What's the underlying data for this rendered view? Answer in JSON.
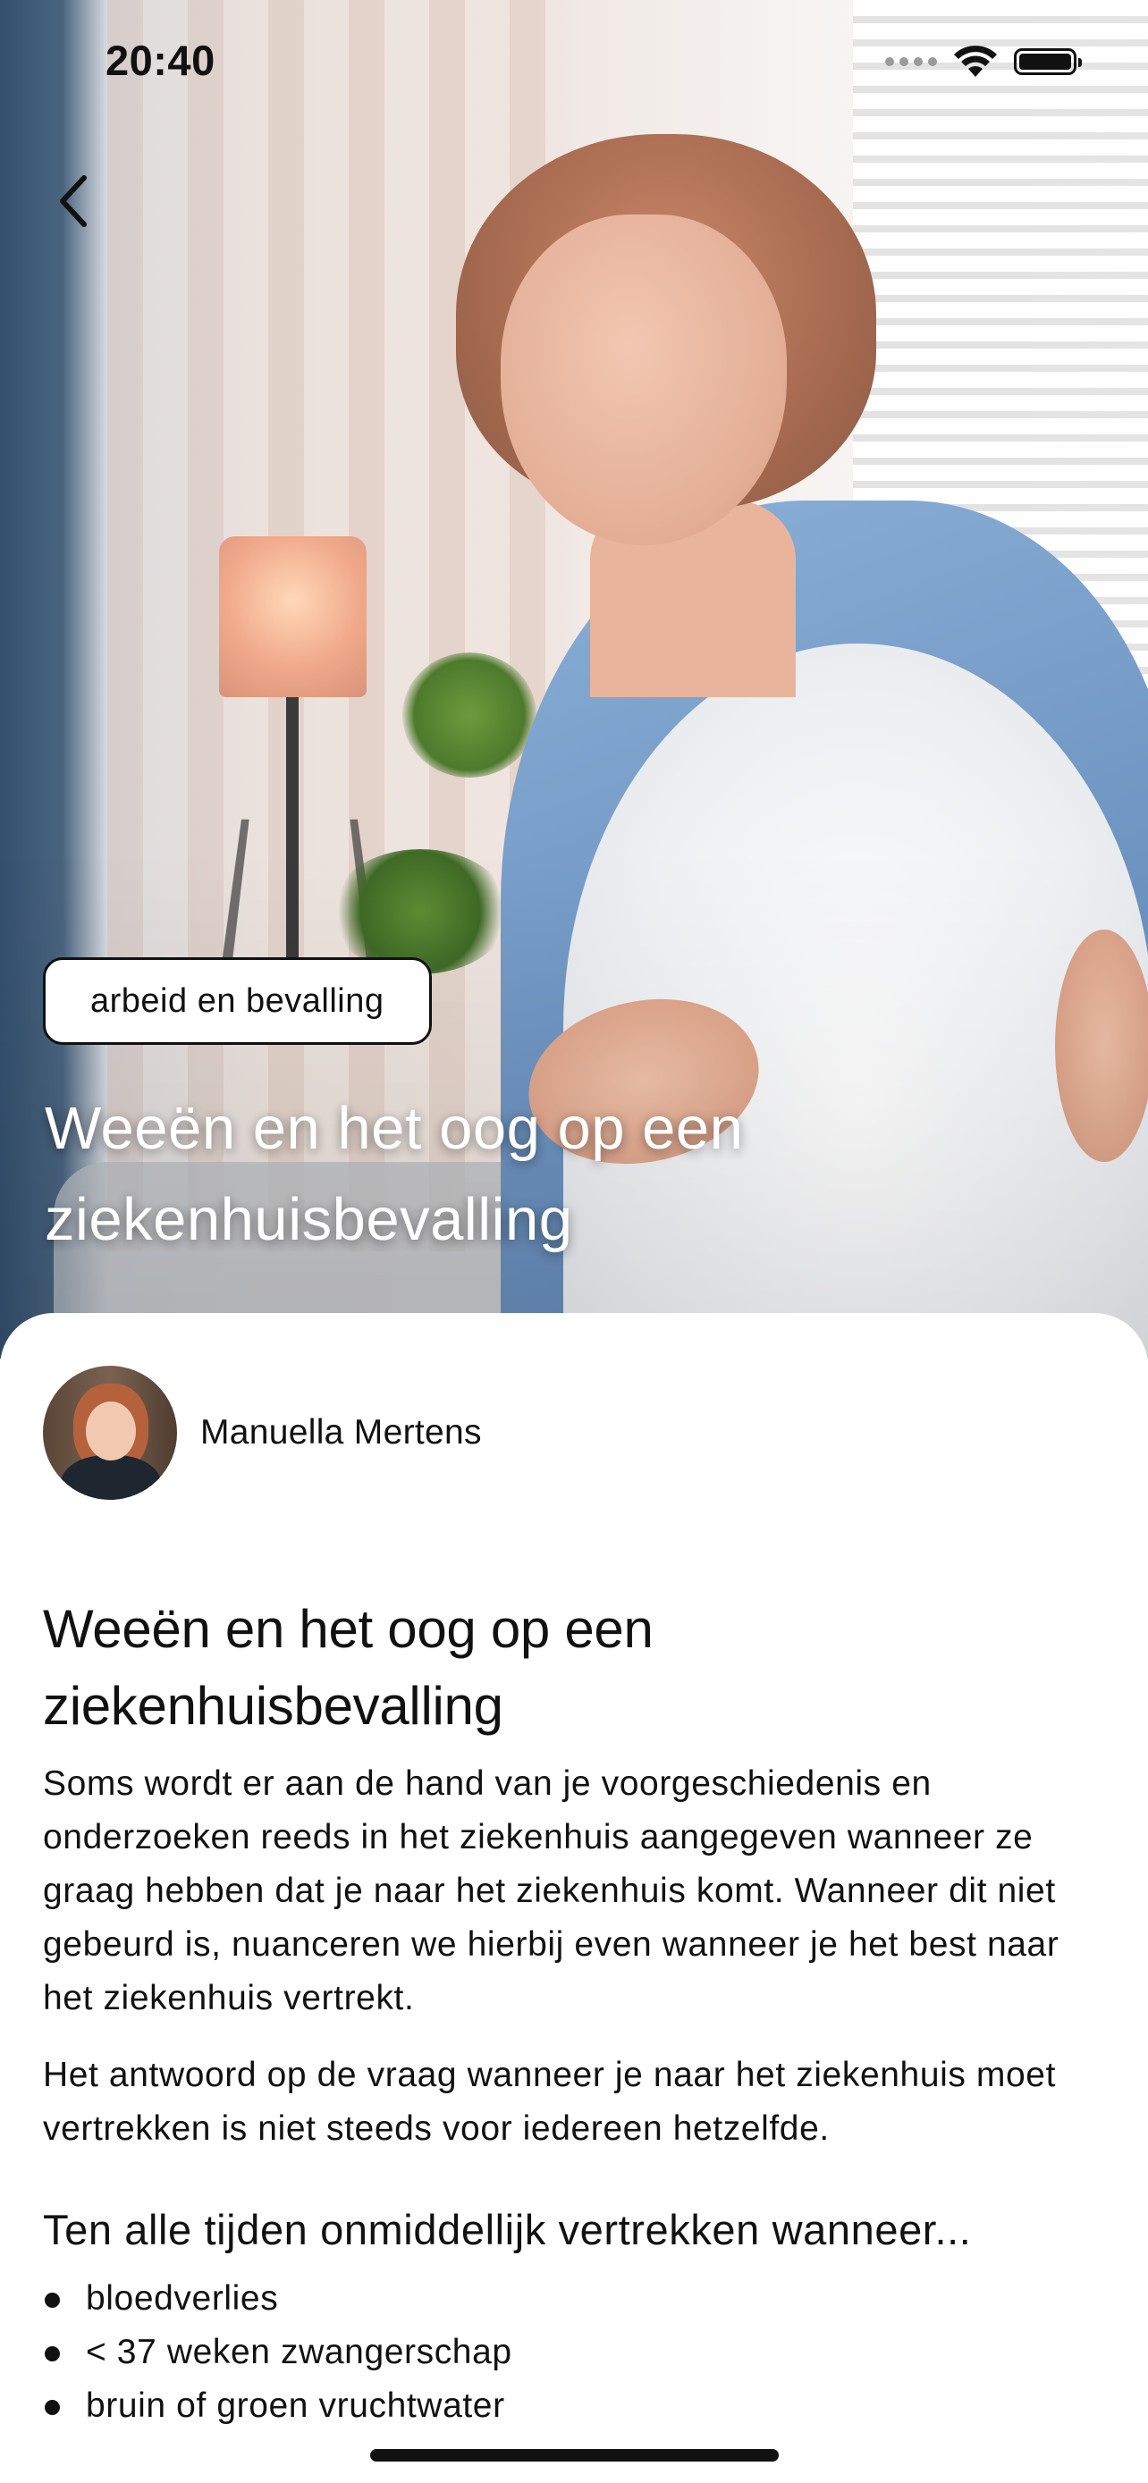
{
  "status_bar": {
    "time": "20:40"
  },
  "hero": {
    "category_label": "arbeid en bevalling",
    "title": "Weeën en het oog op een ziekenhuisbevalling"
  },
  "author": {
    "name": "Manuella Mertens"
  },
  "article": {
    "title": "Weeën en het oog op een ziekenhuisbevalling",
    "paragraphs": [
      "Soms wordt er aan de hand van je voorgeschiedenis en onderzoeken reeds in het ziekenhuis aangegeven wanneer ze graag hebben dat je naar het ziekenhuis komt. Wanneer dit niet gebeurd is, nuanceren we hierbij even wanneer je het best naar het ziekenhuis vertrekt.",
      "Het antwoord op de vraag wanneer je naar het ziekenhuis moet vertrekken is niet steeds voor iedereen hetzelfde."
    ],
    "subheading": "Ten alle tijden onmiddellijk vertrekken wanneer...",
    "bullets": [
      "bloedverlies",
      "< 37 weken zwangerschap",
      "bruin of groen vruchtwater"
    ]
  },
  "icons": {
    "back": "chevron-left-icon",
    "signal": "cellular-signal-icon",
    "wifi": "wifi-icon",
    "battery": "battery-icon"
  },
  "colors": {
    "text": "#111111",
    "background": "#ffffff",
    "hero_title": "#ffffff"
  }
}
